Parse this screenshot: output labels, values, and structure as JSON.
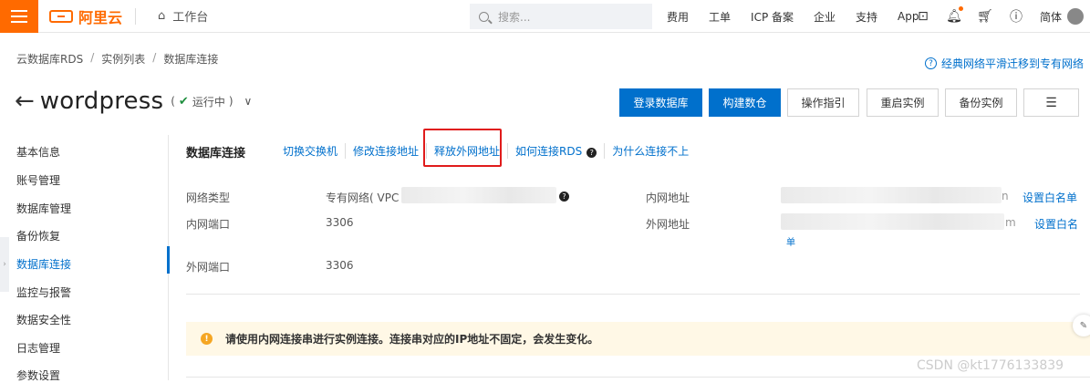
{
  "topbar": {
    "brand": "阿里云",
    "workbench": "工作台",
    "search_placeholder": "搜索...",
    "nav": [
      "费用",
      "工单",
      "ICP 备案",
      "企业",
      "支持",
      "App"
    ],
    "lang": "简体"
  },
  "breadcrumb": [
    "云数据库RDS",
    "实例列表",
    "数据库连接"
  ],
  "migrate_link": "经典网络平滑迁移到专有网络",
  "header": {
    "title": "wordpress",
    "status": "运行中"
  },
  "actions": [
    "登录数据库",
    "构建数仓",
    "操作指引",
    "重启实例",
    "备份实例"
  ],
  "sidebar": {
    "items": [
      "基本信息",
      "账号管理",
      "数据库管理",
      "备份恢复",
      "数据库连接",
      "监控与报警",
      "数据安全性",
      "日志管理",
      "参数设置"
    ],
    "active_index": 4
  },
  "section": {
    "title": "数据库连接",
    "tabs": [
      "切换交换机",
      "修改连接地址",
      "释放外网地址",
      "如何连接RDS",
      "为什么连接不上"
    ]
  },
  "info": {
    "network_type_label": "网络类型",
    "network_type_value": "专有网络( VPC",
    "internal_port_label": "内网端口",
    "internal_port_value": "3306",
    "external_port_label": "外网端口",
    "external_port_value": "3306",
    "internal_addr_label": "内网地址",
    "internal_addr_suffix": "n",
    "external_addr_label": "外网地址",
    "external_addr_suffix": "m",
    "whitelist_link_1": "设置白名单",
    "whitelist_link_2": "设置白名",
    "whitelist_link_2_wrap": "单"
  },
  "alert": {
    "message": "请使用内网连接串进行实例连接。连接串对应的IP地址不固定，会发生变化。"
  },
  "watermark": "CSDN @kt1776133839"
}
